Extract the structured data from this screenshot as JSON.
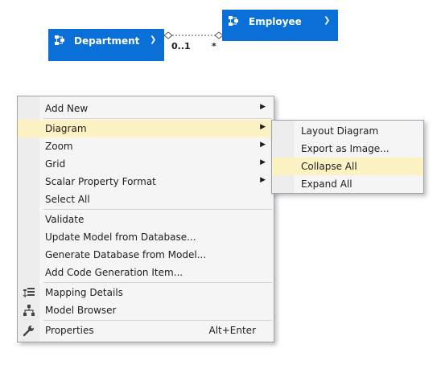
{
  "diagram": {
    "department": {
      "name": "Department"
    },
    "employee": {
      "name": "Employee"
    },
    "association": {
      "department_multiplicity": "0..1",
      "employee_multiplicity": "*"
    }
  },
  "context_menu": {
    "items": [
      {
        "label": "Add New",
        "has_submenu": true
      },
      {
        "label": "Diagram",
        "has_submenu": true,
        "highlighted": true
      },
      {
        "label": "Zoom",
        "has_submenu": true
      },
      {
        "label": "Grid",
        "has_submenu": true
      },
      {
        "label": "Scalar Property Format",
        "has_submenu": true
      },
      {
        "label": "Select All"
      },
      {
        "label": "Validate"
      },
      {
        "label": "Update Model from Database..."
      },
      {
        "label": "Generate Database from Model..."
      },
      {
        "label": "Add Code Generation Item..."
      },
      {
        "label": "Mapping Details",
        "icon": "mapping-details-icon"
      },
      {
        "label": "Model Browser",
        "icon": "model-browser-icon"
      },
      {
        "label": "Properties",
        "icon": "wrench-icon",
        "shortcut": "Alt+Enter"
      }
    ]
  },
  "diagram_submenu": {
    "items": [
      {
        "label": "Layout Diagram"
      },
      {
        "label": "Export as Image..."
      },
      {
        "label": "Collapse All",
        "highlighted": true
      },
      {
        "label": "Expand All"
      }
    ]
  },
  "colors": {
    "entity_fill": "#0a6fd6",
    "menu_background": "#f5f5f5",
    "highlight": "#fdf2c3",
    "menu_border": "#9aa2ae"
  }
}
